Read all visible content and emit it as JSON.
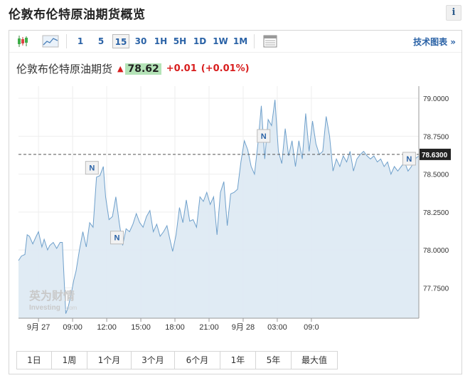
{
  "page_title": "伦敦布伦特原油期货概览",
  "info_label": "i",
  "toolbar": {
    "intervals": [
      "1",
      "5",
      "15",
      "30",
      "1H",
      "5H",
      "1D",
      "1W",
      "1M"
    ],
    "active_interval": "15",
    "tech_chart_label": "技术图表 »"
  },
  "quote": {
    "name": "伦敦布伦特原油期货",
    "arrow": "▲",
    "price": "78.62",
    "change": "+0.01",
    "change_pct": "(+0.01%)",
    "price_bg_color": "#b4e3b7",
    "up_color": "#d81e1e"
  },
  "watermark": {
    "brand_cn": "英为财情",
    "brand_en": "Investing",
    "brand_suffix": ".com"
  },
  "news_marker_label": "N",
  "ranges": [
    "1日",
    "1周",
    "1个月",
    "3个月",
    "6个月",
    "1年",
    "5年",
    "最大值"
  ],
  "chart_data": {
    "type": "area",
    "current_value_label": "78.6300",
    "current_value": 78.63,
    "ylim": [
      77.55,
      79.08
    ],
    "y_ticks": [
      "79.0000",
      "78.7500",
      "78.5000",
      "78.2500",
      "78.0000",
      "77.7500"
    ],
    "x_ticks": [
      "9月 27",
      "09:00",
      "12:00",
      "15:00",
      "18:00",
      "21:00",
      "9月 28",
      "03:00",
      "09:0"
    ],
    "x_range_hours": [
      -1.76,
      33.45
    ],
    "x": [
      -1.76,
      -1.5,
      -1.2,
      -1.0,
      -0.8,
      -0.5,
      -0.2,
      0.0,
      0.3,
      0.5,
      0.8,
      1.0,
      1.3,
      1.6,
      1.9,
      2.1,
      2.4,
      2.6,
      2.9,
      3.1,
      3.3,
      3.6,
      3.9,
      4.2,
      4.5,
      4.8,
      5.1,
      5.4,
      5.7,
      5.9,
      6.2,
      6.5,
      6.8,
      7.1,
      7.4,
      7.7,
      8.0,
      8.3,
      8.6,
      8.9,
      9.2,
      9.5,
      9.8,
      10.1,
      10.4,
      10.7,
      11.0,
      11.3,
      11.5,
      11.8,
      12.1,
      12.4,
      12.7,
      13.0,
      13.3,
      13.6,
      13.9,
      14.2,
      14.5,
      14.8,
      15.1,
      15.4,
      15.7,
      16.0,
      16.3,
      16.6,
      16.9,
      17.2,
      17.5,
      17.8,
      18.1,
      18.4,
      18.7,
      19.0,
      19.3,
      19.6,
      19.9,
      20.2,
      20.5,
      20.8,
      21.1,
      21.4,
      21.7,
      22.0,
      22.3,
      22.6,
      22.9,
      23.2,
      23.5,
      23.8,
      24.1,
      24.4,
      24.7,
      25.0,
      25.3,
      25.6,
      25.9,
      26.2,
      26.5,
      26.8,
      27.1,
      27.4,
      27.7,
      28.0,
      28.3,
      28.6,
      28.9,
      29.2,
      29.5,
      29.8,
      30.1,
      30.4,
      30.7,
      31.0,
      31.3,
      31.6,
      31.9,
      32.2,
      32.5,
      32.8,
      33.1,
      33.45
    ],
    "y": [
      77.93,
      77.96,
      77.97,
      78.1,
      78.09,
      78.04,
      78.09,
      78.12,
      78.02,
      78.07,
      78.0,
      78.03,
      78.05,
      78.01,
      78.05,
      78.05,
      77.58,
      77.62,
      77.72,
      77.8,
      77.86,
      78.0,
      78.12,
      78.02,
      78.18,
      78.15,
      78.48,
      78.49,
      78.55,
      78.35,
      78.2,
      78.22,
      78.35,
      78.18,
      78.03,
      78.14,
      78.12,
      78.17,
      78.24,
      78.18,
      78.15,
      78.22,
      78.26,
      78.12,
      78.17,
      78.09,
      78.12,
      78.16,
      78.09,
      77.99,
      78.1,
      78.28,
      78.18,
      78.33,
      78.19,
      78.2,
      78.15,
      78.35,
      78.32,
      78.38,
      78.3,
      78.35,
      78.1,
      78.38,
      78.45,
      78.16,
      78.37,
      78.38,
      78.4,
      78.58,
      78.72,
      78.66,
      78.55,
      78.5,
      78.7,
      78.95,
      78.6,
      78.86,
      78.82,
      78.99,
      78.65,
      78.57,
      78.8,
      78.62,
      78.72,
      78.55,
      78.72,
      78.6,
      78.9,
      78.65,
      78.85,
      78.7,
      78.63,
      78.65,
      78.88,
      78.75,
      78.52,
      78.6,
      78.55,
      78.62,
      78.58,
      78.65,
      78.52,
      78.6,
      78.63,
      78.65,
      78.62,
      78.6,
      78.62,
      78.58,
      78.6,
      78.55,
      78.58,
      78.5,
      78.55,
      78.52,
      78.55,
      78.58,
      78.52,
      78.55,
      78.6,
      78.62
    ]
  }
}
